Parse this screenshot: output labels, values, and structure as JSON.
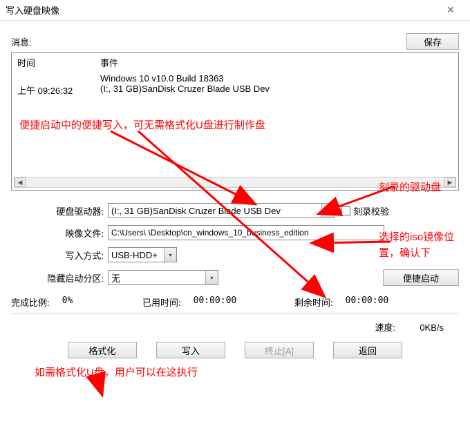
{
  "window": {
    "title": "写入硬盘映像"
  },
  "msg": {
    "label": "消息:",
    "save_btn": "保存"
  },
  "log": {
    "col_time": "时间",
    "col_event": "事件",
    "rows": [
      {
        "time": "",
        "event": "Windows 10 v10.0 Build 18363"
      },
      {
        "time": "上午 09:26:32",
        "event": "(I:, 31 GB)SanDisk Cruzer Blade USB Dev"
      }
    ]
  },
  "fields": {
    "drive_label": "硬盘驱动器:",
    "drive_value": "(I:, 31 GB)SanDisk Cruzer Blade USB Dev",
    "verify_label": "刻录校验",
    "image_label": "映像文件:",
    "image_value": "C:\\Users\\        \\Desktop\\cn_windows_10_business_edition",
    "write_method_label": "写入方式:",
    "write_method_value": "USB-HDD+",
    "hidden_boot_label": "隐藏启动分区:",
    "hidden_boot_value": "无",
    "quick_boot_btn": "便捷启动"
  },
  "stats": {
    "progress_label": "完成比例:",
    "progress_value": "0%",
    "elapsed_label": "已用时间:",
    "elapsed_value": "00:00:00",
    "remaining_label": "剩余时间:",
    "remaining_value": "00:00:00",
    "speed_label": "速度:",
    "speed_value": "0KB/s"
  },
  "buttons": {
    "format": "格式化",
    "write": "写入",
    "abort": "终止[A]",
    "back": "返回"
  },
  "annotations": {
    "a1": "便捷启动中的便捷写入，可无需格式化U盘进行制作盘",
    "a2": "刻录的驱动盘",
    "a3": "选择的iso镜像位置，确认下",
    "a4": "如需格式化U盘，用户可以在这执行"
  }
}
